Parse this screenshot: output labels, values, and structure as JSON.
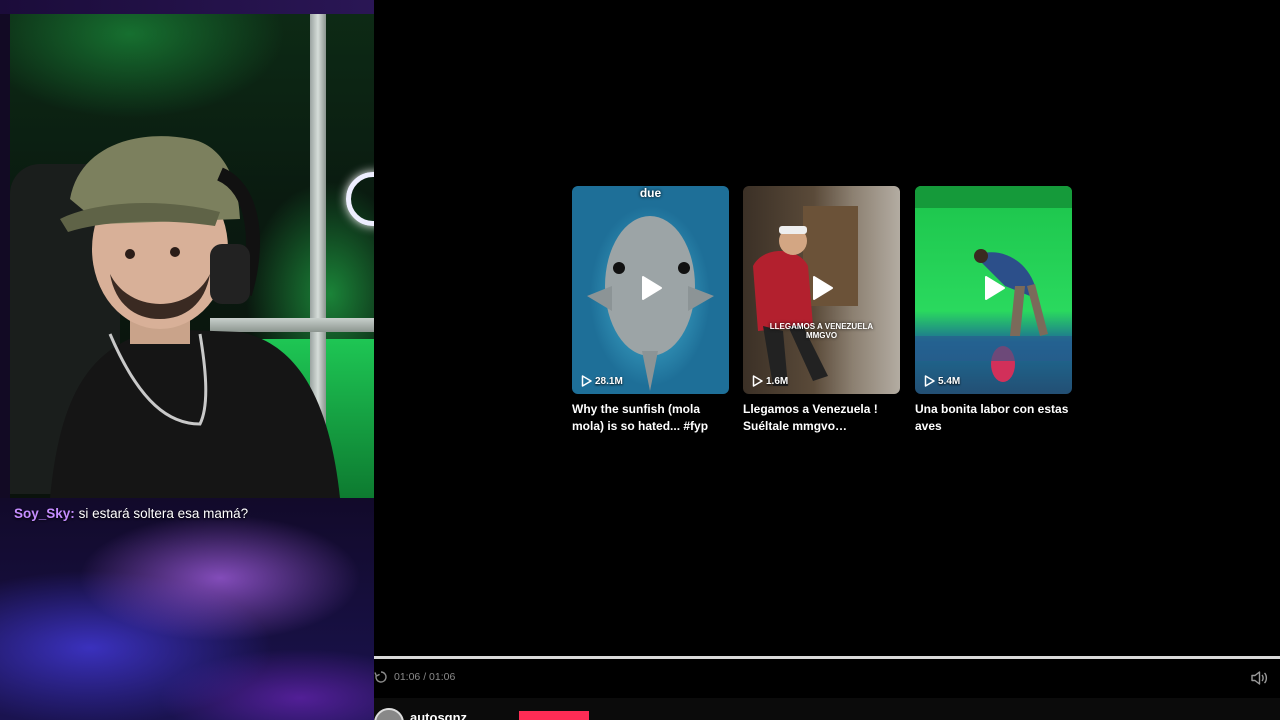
{
  "chat": {
    "username": "Soy_Sky:",
    "message": "si estará soltera esa mamá?"
  },
  "videos": [
    {
      "title": "Why the sunfish (mola mola) is so hated... #fyp",
      "views": "28.1M",
      "overlay": "due"
    },
    {
      "title": "Llegamos a Venezuela ! Suéltale mmgvo #delaghet...",
      "views": "1.6M",
      "overlay": "LLEGAMOS A VENEZUELA MMGVO"
    },
    {
      "title": "Una bonita labor con estas aves",
      "views": "5.4M",
      "overlay": ""
    }
  ],
  "player": {
    "current_time": "01:06",
    "duration": "01:06",
    "time_display": "01:06 / 01:06",
    "progress": 1.0
  },
  "author": {
    "name": "autosgnz"
  },
  "colors": {
    "accent": "#fe2c55",
    "chat_username": "#c58dff"
  }
}
